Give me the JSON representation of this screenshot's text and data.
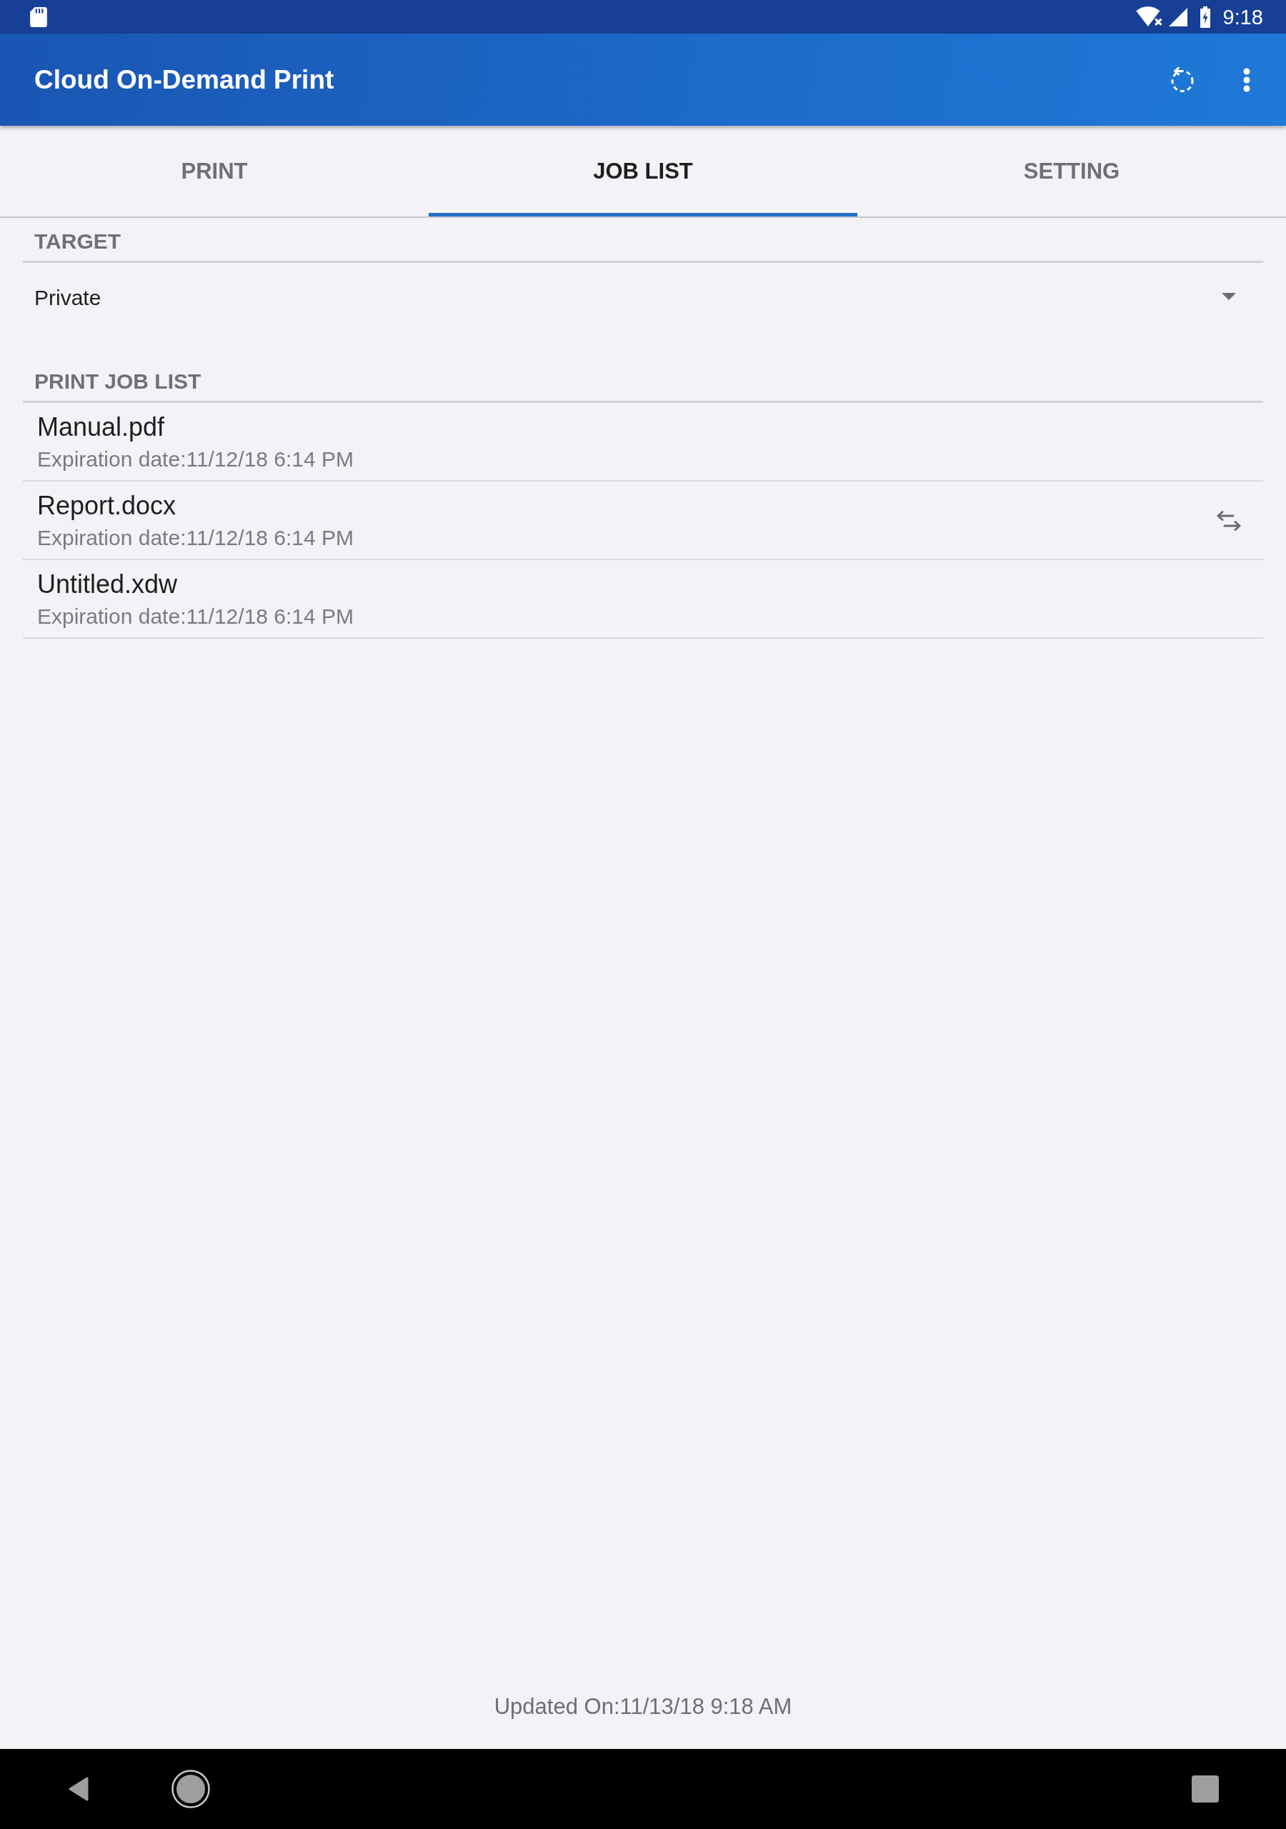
{
  "status_bar": {
    "time": "9:18"
  },
  "app_bar": {
    "title": "Cloud On-Demand Print"
  },
  "tabs": [
    {
      "label": "PRINT",
      "selected": false
    },
    {
      "label": "JOB LIST",
      "selected": true
    },
    {
      "label": "SETTING",
      "selected": false
    }
  ],
  "target": {
    "header": "TARGET",
    "value": "Private"
  },
  "job_list": {
    "header": "PRINT JOB LIST",
    "jobs": [
      {
        "name": "Manual.pdf",
        "expiration": "Expiration date:11/12/18 6:14 PM",
        "transfer_mark": false
      },
      {
        "name": "Report.docx",
        "expiration": "Expiration date:11/12/18 6:14 PM",
        "transfer_mark": true
      },
      {
        "name": "Untitled.xdw",
        "expiration": "Expiration date:11/12/18 6:14 PM",
        "transfer_mark": false
      }
    ]
  },
  "footer": {
    "updated": "Updated On:11/13/18 9:18 AM"
  }
}
